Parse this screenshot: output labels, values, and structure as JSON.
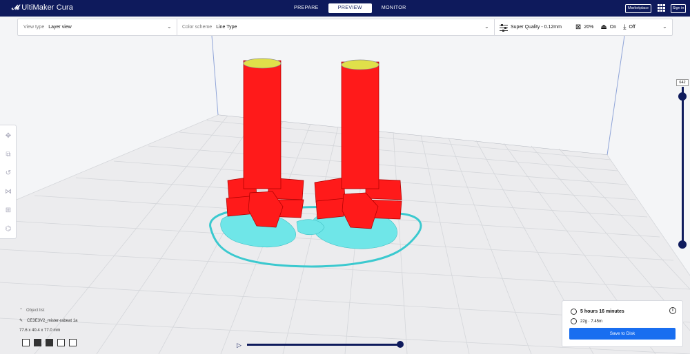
{
  "app": {
    "title": "UltiMaker Cura",
    "logo_mark": "ꟽ"
  },
  "stages": [
    {
      "label": "PREPARE",
      "active": false
    },
    {
      "label": "PREVIEW",
      "active": true
    },
    {
      "label": "MONITOR",
      "active": false
    }
  ],
  "topbar": {
    "marketplace": "Marketplace",
    "signin": "Sign in"
  },
  "header": {
    "view_type_label": "View type",
    "view_type_value": "Layer view",
    "color_scheme_label": "Color scheme",
    "color_scheme_value": "Line Type",
    "profile": "Super Quality - 0.12mm",
    "infill": "20%",
    "support": "On",
    "adhesion": "Off"
  },
  "layer": {
    "current": "642"
  },
  "object_list": {
    "header": "Object list",
    "object_name": "CE3E3V2_mister-rabeat 1a",
    "dimensions": "77.6 x 40.4 x 77.0 mm"
  },
  "estimate": {
    "time": "5 hours 16 minutes",
    "material": "22g · 7.45m",
    "save_label": "Save to Disk"
  },
  "colors": {
    "topbar": "#0e1a5c",
    "model_red": "#ff1a1a",
    "support_cyan": "#5ee8ea",
    "infill_yellow": "#e0e04a",
    "accent_blue": "#196ef0"
  },
  "icons": {
    "move": "move-icon",
    "scale": "scale-icon",
    "rotate": "rotate-icon",
    "mirror": "mirror-icon",
    "per-model": "per-model-settings-icon",
    "support-blocker": "support-blocker-icon"
  }
}
